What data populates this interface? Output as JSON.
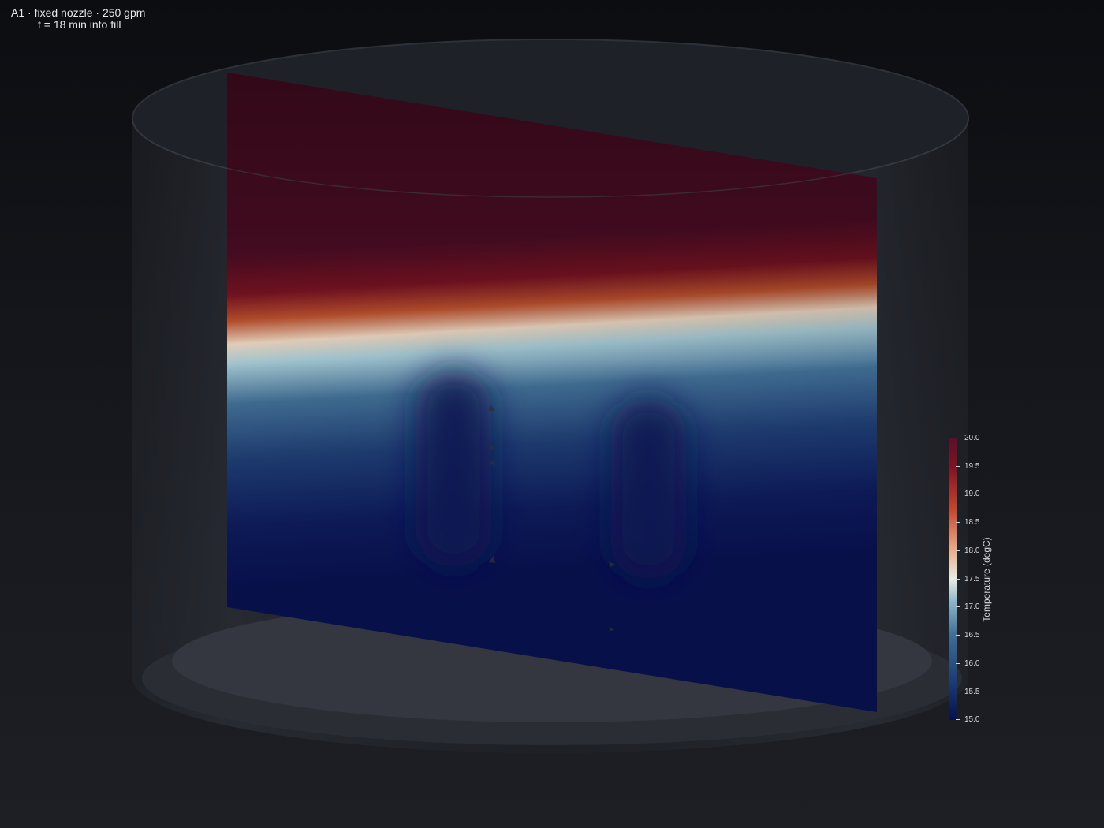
{
  "title": {
    "line1": "A1 · fixed nozzle · 250 gpm",
    "line2": "t = 18 min into fill"
  },
  "scene": {
    "objects": [
      "tank-shell",
      "tank-floor",
      "temperature-slice-plane",
      "inlet-plume-left",
      "inlet-plume-right"
    ],
    "field": "Temperature"
  },
  "colorbar": {
    "title": "Temperature (degC)",
    "range": [
      15.0,
      20.0
    ],
    "colormap": "RdBu_r",
    "colors": [
      "#07114a",
      "#1a3a74",
      "#3f6d94",
      "#8cb6c9",
      "#e9ece4",
      "#e8b08e",
      "#c2452e",
      "#7d1424",
      "#5c0f2b"
    ],
    "ticks": [
      "20.0",
      "19.5",
      "19.0",
      "18.5",
      "18.0",
      "17.5",
      "17.0",
      "16.5",
      "16.0",
      "15.5",
      "15.0"
    ]
  },
  "colors": {
    "background_top": "#0c0d11",
    "background_bottom": "#1d1f25",
    "text": "#e8e8ea"
  }
}
